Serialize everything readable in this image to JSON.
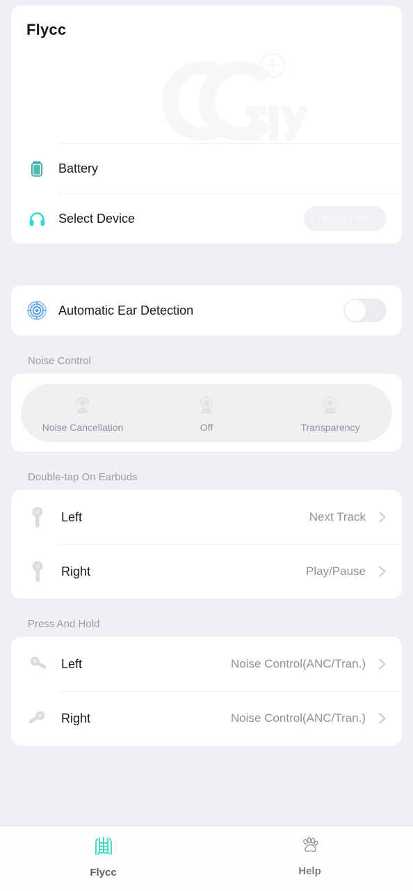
{
  "header": {
    "app_title": "Flycc",
    "watermark_text": "fly",
    "watermark_icon": "cc-fly-logo-watermark"
  },
  "device_card": {
    "battery": {
      "icon": "battery-icon",
      "label": "Battery"
    },
    "select_device": {
      "icon": "headphones-icon",
      "label": "Select Device",
      "button_label": "Disconnect"
    }
  },
  "ear_detection": {
    "icon": "ear-detection-target-icon",
    "label": "Automatic Ear Detection",
    "toggle_state": "off"
  },
  "noise_control": {
    "section_title": "Noise Control",
    "selected": "none",
    "options": [
      {
        "label": "Noise Cancellation",
        "icon": "person-solid-ring-icon"
      },
      {
        "label": "Off",
        "icon": "person-dashed-ring-icon"
      },
      {
        "label": "Transparency",
        "icon": "person-dotted-rays-icon"
      }
    ]
  },
  "double_tap": {
    "section_title": "Double-tap On Earbuds",
    "rows": [
      {
        "name": "Left",
        "value": "Next Track",
        "icon": "earbud-left-icon",
        "chevron": "chevron-right-icon"
      },
      {
        "name": "Right",
        "value": "Play/Pause",
        "icon": "earbud-right-icon",
        "chevron": "chevron-right-icon"
      }
    ]
  },
  "press_and_hold": {
    "section_title": "Press And Hold",
    "rows": [
      {
        "name": "Left",
        "value": "Noise Control(ANC/Tran.)",
        "icon": "earbud-tilted-left-icon",
        "chevron": "chevron-right-icon"
      },
      {
        "name": "Right",
        "value": "Noise Control(ANC/Tran.)",
        "icon": "earbud-tilted-right-icon",
        "chevron": "chevron-right-icon"
      }
    ]
  },
  "tabbar": {
    "tabs": [
      {
        "label": "Flycc",
        "icon": "flycc-glyph-icon",
        "active": true
      },
      {
        "label": "Help",
        "icon": "paw-print-icon",
        "active": false
      }
    ]
  },
  "colors": {
    "background": "#eff0f4",
    "card": "#ffffff",
    "teal": "#3fb8ad",
    "cyan": "#2fd8d0",
    "accent_blue": "#5b9fe3",
    "tab_active": "#3fd9c4",
    "muted_text": "#8e9298",
    "primary_text": "#16181d"
  }
}
